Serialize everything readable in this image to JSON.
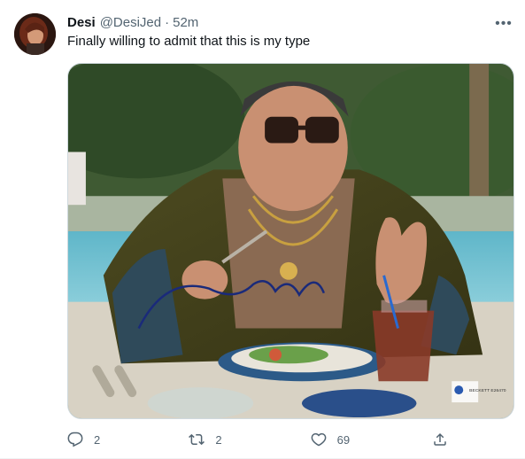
{
  "tweet": {
    "author_name": "Desi",
    "author_handle": "@DesiJed",
    "separator": "·",
    "timestamp": "52m",
    "text": "Finally willing to admit that this is my type",
    "more_label": "•••"
  },
  "media": {
    "signature_text": "Elliott Gould",
    "watermark_label": "BECKETT E26470"
  },
  "actions": {
    "reply_count": "2",
    "retweet_count": "2",
    "like_count": "69"
  },
  "colors": {
    "text_primary": "#0f1419",
    "text_secondary": "#536471",
    "border": "#cfd9de"
  },
  "icons": {
    "reply": "reply-icon",
    "retweet": "retweet-icon",
    "like": "heart-icon",
    "share": "share-icon",
    "more": "more-icon"
  }
}
